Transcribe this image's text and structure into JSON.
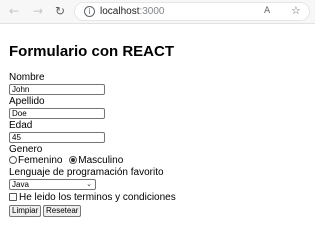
{
  "browser": {
    "url_host": "localhost",
    "url_port": ":3000",
    "icons": {
      "back": "arrow-left-icon",
      "forward": "arrow-right-icon",
      "reload": "reload-icon",
      "site_info": "info-icon",
      "translate": "translate-icon",
      "favorites": "star-icon"
    }
  },
  "form": {
    "title": "Formulario con REACT",
    "nombre_label": "Nombre",
    "nombre_value": "John",
    "apellido_label": "Apellido",
    "apellido_value": "Doe",
    "edad_label": "Edad",
    "edad_value": "45",
    "genero_label": "Genero",
    "genero_options": [
      "Femenino",
      "Masculino"
    ],
    "genero_selected": "Masculino",
    "lenguaje_label": "Lenguaje de programación favorito",
    "lenguaje_value": "Java",
    "terms_label": "He leido los terminos y condiciones",
    "terms_checked": false,
    "clear_button": "Limpiar",
    "reset_button": "Resetear"
  }
}
